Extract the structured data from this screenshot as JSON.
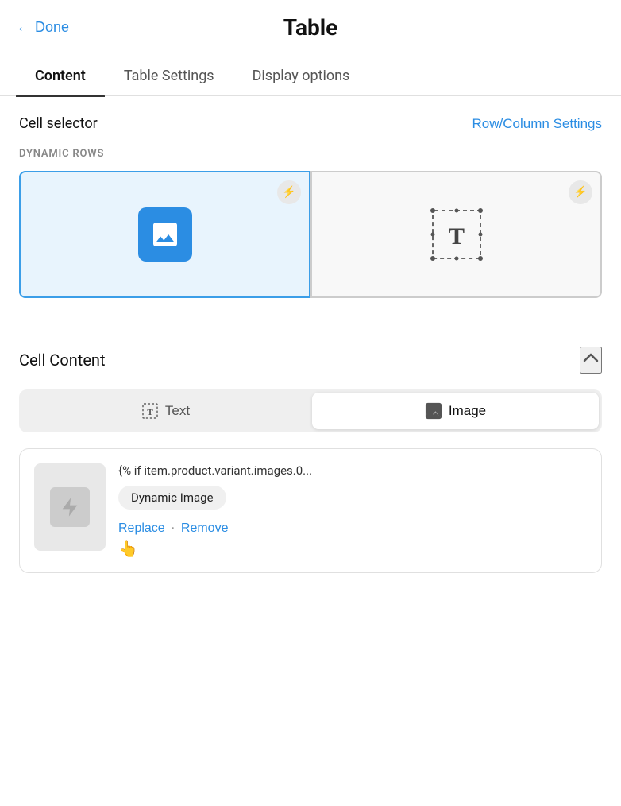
{
  "header": {
    "done_label": "Done",
    "title": "Table"
  },
  "tabs": [
    {
      "id": "content",
      "label": "Content",
      "active": true
    },
    {
      "id": "table-settings",
      "label": "Table Settings",
      "active": false
    },
    {
      "id": "display-options",
      "label": "Display options",
      "active": false
    }
  ],
  "cell_selector": {
    "label": "Cell selector",
    "row_col_settings_label": "Row/Column Settings"
  },
  "dynamic_rows": {
    "section_label": "DYNAMIC ROWS",
    "cells": [
      {
        "id": "image-cell",
        "type": "image",
        "active": true
      },
      {
        "id": "text-cell",
        "type": "text",
        "active": false
      }
    ]
  },
  "cell_content": {
    "title": "Cell Content",
    "toggle": {
      "text_label": "Text",
      "image_label": "Image",
      "active": "image"
    },
    "image_card": {
      "template_text": "{% if item.product.variant.images.0...",
      "badge_label": "Dynamic Image",
      "replace_label": "Replace",
      "remove_label": "Remove"
    }
  },
  "icons": {
    "lightning": "⚡",
    "chevron_up": "∧"
  }
}
